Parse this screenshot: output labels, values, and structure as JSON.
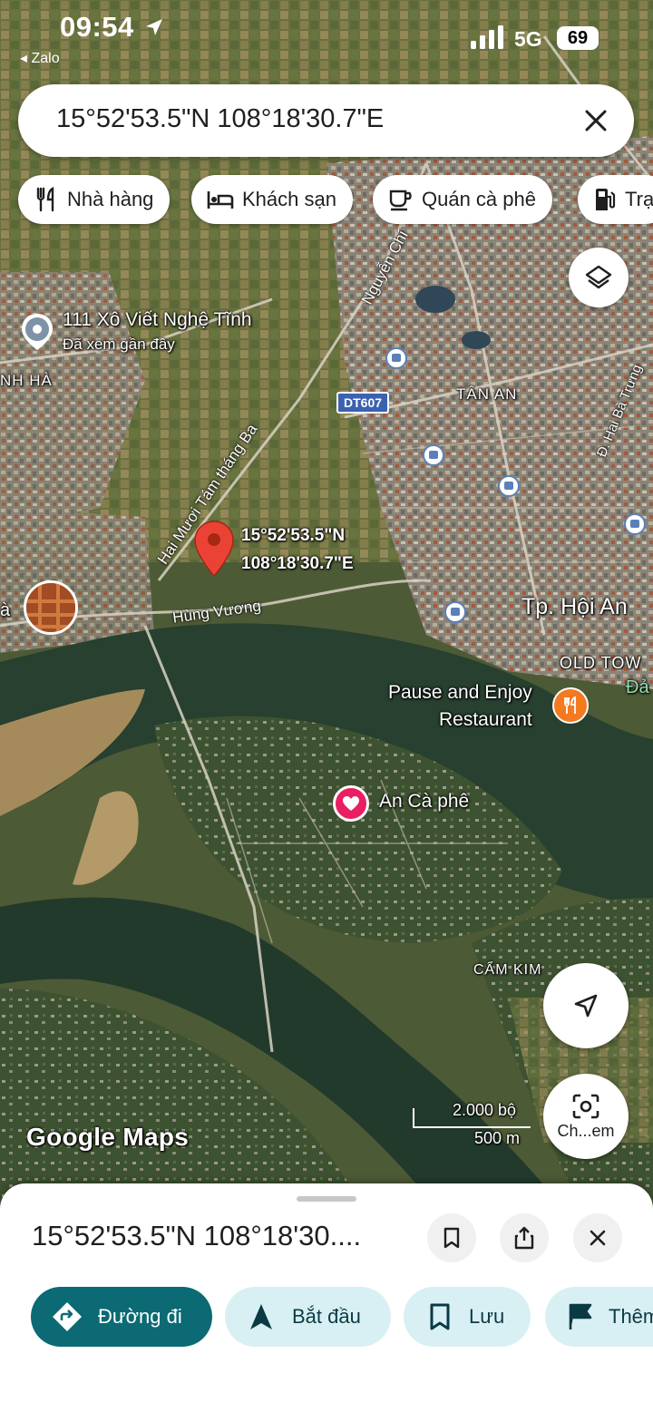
{
  "status": {
    "time": "09:54",
    "back_app": "◂ Zalo",
    "network": "5G",
    "battery": "69"
  },
  "search": {
    "value": "15°52'53.5\"N 108°18'30.7\"E"
  },
  "chips": [
    {
      "label": "Nhà hàng",
      "icon": "restaurant-icon"
    },
    {
      "label": "Khách sạn",
      "icon": "hotel-icon"
    },
    {
      "label": "Quán cà phê",
      "icon": "coffee-icon"
    },
    {
      "label": "Trạ",
      "icon": "gas-station-icon"
    }
  ],
  "map": {
    "recent_place": {
      "title": "111 Xô Viết Nghệ Tĩnh",
      "subtitle": "Đã xem gần đây"
    },
    "pin": {
      "line1": "15°52'53.5\"N",
      "line2": "108°18'30.7\"E"
    },
    "areas": {
      "tan_an": "TÂN AN",
      "nh_ha": "NH HÀ",
      "hoi_an": "Tp. Hội An",
      "old_town": "OLD TOW",
      "cam_kim": "CẨM KIM",
      "left_a": "à",
      "right_da": "Đả"
    },
    "roads": {
      "hai_muoi": "Hai Mươi Tám tháng Ba",
      "hung_vuong": "Hùng Vương",
      "nguyen": "Nguyễn Chí",
      "hai_ba": "Đ. Hai Bà Trưng"
    },
    "route_badge": "DT607",
    "restaurant": {
      "line1": "Pause and Enjoy",
      "line2": "Restaurant"
    },
    "cafe": "An Cà phê",
    "scale": {
      "imperial": "2.000 bộ",
      "metric": "500 m"
    },
    "logo": "Google Maps",
    "camera_label": "Ch...em"
  },
  "sheet": {
    "title": "15°52'53.5\"N 108°18'30....",
    "actions": [
      {
        "label": "Đường đi",
        "icon": "directions-icon"
      },
      {
        "label": "Bắt đầu",
        "icon": "navigation-icon"
      },
      {
        "label": "Lưu",
        "icon": "bookmark-icon"
      },
      {
        "label": "Thêm",
        "icon": "flag-icon"
      }
    ]
  },
  "colors": {
    "primary": "#0b6a74",
    "tonal_button": "#d8f0f4",
    "pin_red": "#ea4335",
    "restaurant_orange": "#f4791f",
    "heart_pink": "#e91e63"
  }
}
